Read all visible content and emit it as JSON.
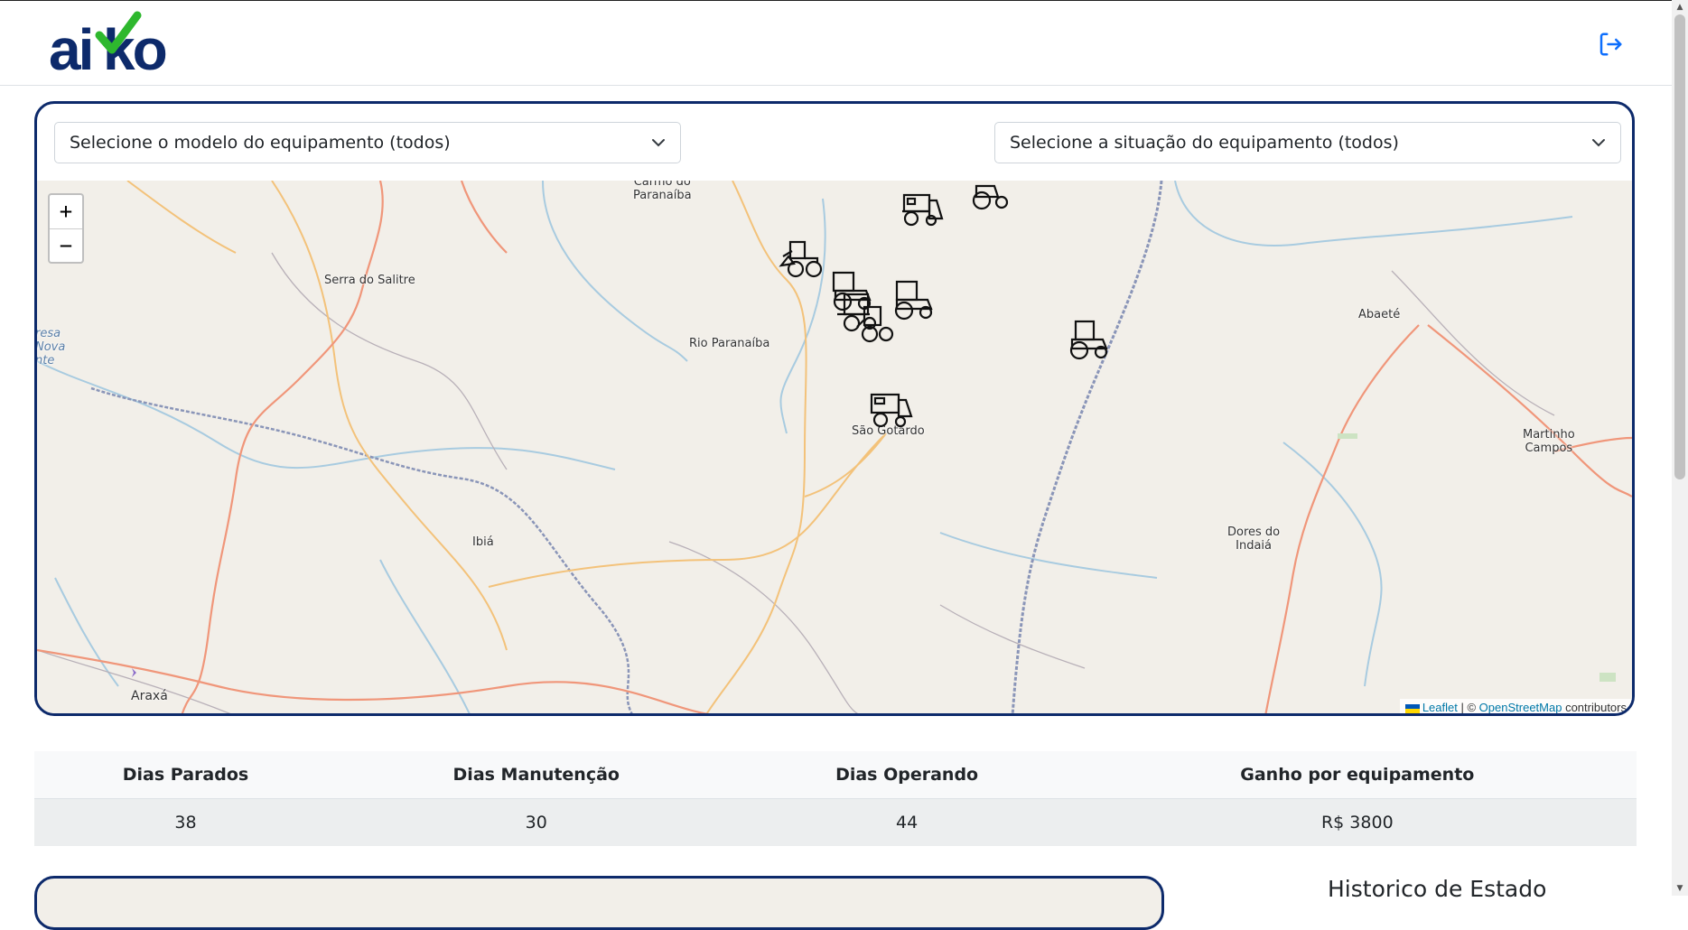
{
  "header": {
    "logo_text": "aiko",
    "logout_icon": "logout-icon"
  },
  "filters": {
    "model_select": "Selecione o modelo do equipamento (todos)",
    "status_select": "Selecione a situação do equipamento (todos)"
  },
  "map": {
    "zoom_in": "+",
    "zoom_out": "−",
    "places": [
      {
        "name": "Carmo do\nParanaíba"
      },
      {
        "name": "Serra do Salitre"
      },
      {
        "name": "Rio Paranaíba"
      },
      {
        "name": "São Gotardo"
      },
      {
        "name": "Abaeté"
      },
      {
        "name": "Martinho\nCampos"
      },
      {
        "name": "Dores do\nIndaiá"
      },
      {
        "name": "Ibiá"
      },
      {
        "name": "Araxá"
      },
      {
        "name": "resa\nNova\nnte"
      }
    ],
    "attribution": {
      "leaflet": "Leaflet",
      "separator": " | © ",
      "osm": "OpenStreetMap",
      "suffix": " contributors"
    },
    "marker_icons": [
      "harvester-icon",
      "loader-icon",
      "tractor-icon"
    ]
  },
  "stats": {
    "headers": [
      "Dias Parados",
      "Dias Manutenção",
      "Dias Operando",
      "Ganho por equipamento"
    ],
    "values": [
      "38",
      "30",
      "44",
      "R$ 3800"
    ]
  },
  "history": {
    "title": "Historico de Estado"
  },
  "colors": {
    "brand_navy": "#0d2a6b",
    "brand_green": "#2eb82e",
    "link_blue": "#0d6efd"
  }
}
